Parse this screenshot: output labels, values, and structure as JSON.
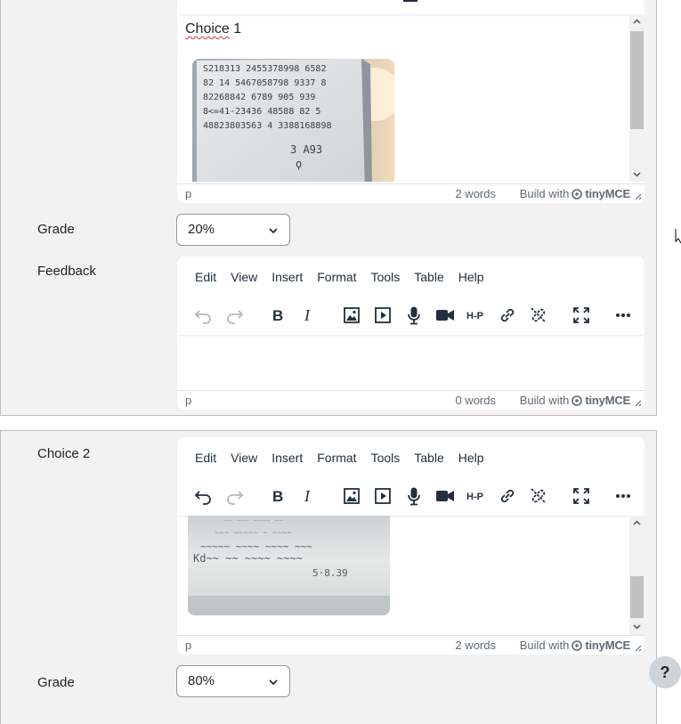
{
  "choice1": {
    "editor_text": "Choice",
    "editor_text_num": " 1",
    "image_label": "math equations on whiteboard",
    "status_path": "p",
    "words": "2 words",
    "build_with": "Build with",
    "brand": "tinyMCE"
  },
  "grade1": {
    "label": "Grade",
    "value": "20%"
  },
  "feedback": {
    "label": "Feedback",
    "menu": [
      "Edit",
      "View",
      "Insert",
      "Format",
      "Tools",
      "Table",
      "Help"
    ],
    "status_path": "p",
    "words": "0 words",
    "build_with": "Build with",
    "brand": "tinyMCE"
  },
  "choice2": {
    "label": "Choice 2",
    "menu": [
      "Edit",
      "View",
      "Insert",
      "Format",
      "Tools",
      "Table",
      "Help"
    ],
    "status_path": "p",
    "words": "2 words",
    "build_with": "Build with",
    "brand": "tinyMCE"
  },
  "grade2": {
    "label": "Grade",
    "value": "80%"
  },
  "help": {
    "label": "?"
  },
  "toolbar_icons": [
    "undo-icon",
    "redo-icon",
    "bold-icon",
    "italic-icon",
    "image-icon",
    "media-icon",
    "record-audio-icon",
    "record-video-icon",
    "h5p-icon",
    "link-icon",
    "unlink-icon",
    "fullscreen-icon",
    "more-icon"
  ],
  "colors": {
    "panel_bg": "#f2f2f2",
    "editor_bg": "#ffffff",
    "text": "#1d2125",
    "toolbar_icon": "#222f3e",
    "disabled_icon": "#b4b8bd"
  }
}
